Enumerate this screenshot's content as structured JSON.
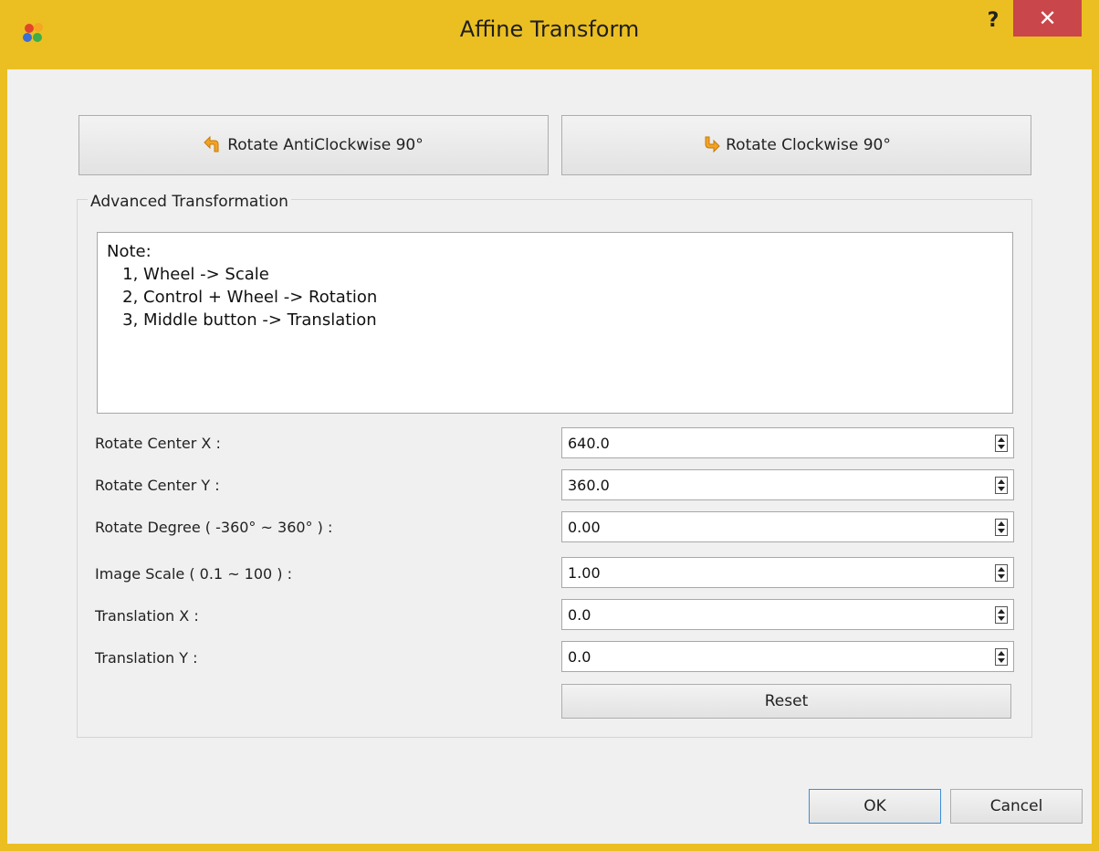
{
  "window": {
    "title": "Affine Transform",
    "help_label": "?",
    "close_label": "✕"
  },
  "rotate": {
    "anticlockwise_label": "Rotate AntiClockwise 90°",
    "clockwise_label": "Rotate Clockwise 90°"
  },
  "advanced": {
    "title": "Advanced Transformation",
    "note": [
      "Note:",
      "   1, Wheel -> Scale",
      "   2, Control + Wheel -> Rotation",
      "   3, Middle button -> Translation"
    ],
    "fields": [
      {
        "label": "Rotate Center X :",
        "value": "640.0"
      },
      {
        "label": "Rotate Center Y :",
        "value": "360.0"
      },
      {
        "label": "Rotate Degree ( -360° ~ 360° ) :",
        "value": "0.00"
      },
      {
        "label": "Image Scale ( 0.1 ~ 100 ) :",
        "value": "1.00"
      },
      {
        "label": "Translation X  :",
        "value": "0.0"
      },
      {
        "label": "Translation Y  :",
        "value": "0.0"
      }
    ],
    "reset_label": "Reset"
  },
  "footer": {
    "ok_label": "OK",
    "cancel_label": "Cancel"
  }
}
